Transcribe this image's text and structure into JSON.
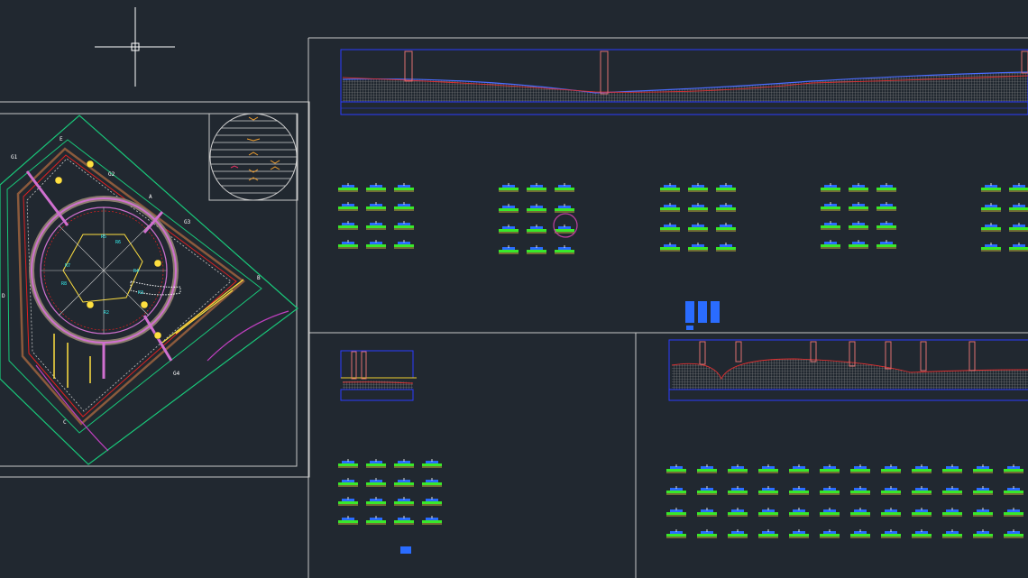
{
  "site_plan": {
    "point_labels": [
      "G1",
      "G2",
      "G3",
      "G4",
      "A",
      "B",
      "C",
      "D",
      "E"
    ],
    "block_labels": [
      "R5",
      "R6",
      "R7",
      "R8",
      "R4",
      "R3",
      "R2"
    ]
  },
  "colors": {
    "background": "#212830",
    "frame": "#c8c8c8",
    "boundary": "#19c87a",
    "road_edge": "#ffe040",
    "ring": "#d070d0",
    "profile_ground": "#a0a0a0",
    "profile_line_red": "#e03030",
    "profile_line_blue": "#4a6cff",
    "section_green": "#39e82a",
    "section_blue": "#2a6cff",
    "section_yellow": "#f5e23a",
    "highlight_circle": "#c040a0"
  },
  "icons": {
    "crosshair": "crosshair-cursor-icon",
    "north_disc": "section-key-disc"
  }
}
